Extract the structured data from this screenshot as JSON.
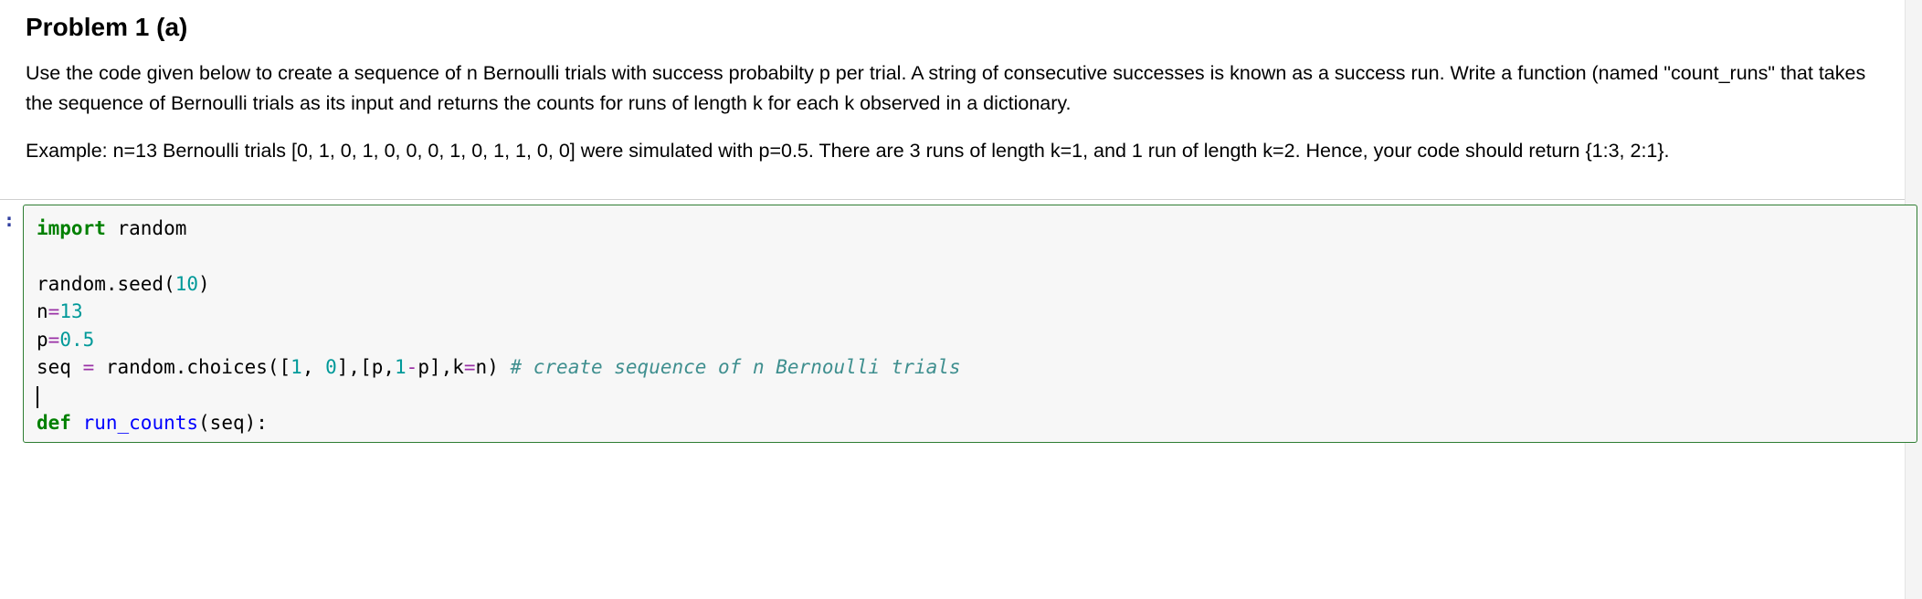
{
  "markdown": {
    "heading": "Problem 1 (a)",
    "para1": "Use the code given below to create a sequence of n Bernoulli trials with success probabilty p per trial. A string of consecutive successes is known as a success run. Write a function (named \"count_runs\" that takes the sequence of Bernoulli trials as its input and returns the counts for runs of length k for each k observed in a dictionary.",
    "para2": "Example: n=13 Bernoulli trials [0, 1, 0, 1, 0, 0, 0, 1, 0, 1, 1, 0, 0] were simulated with p=0.5. There are 3 runs of length k=1, and 1 run of length k=2. Hence, your code should return {1:3, 2:1}."
  },
  "prompt": {
    "label": ":"
  },
  "code": {
    "line1": {
      "kw_import": "import",
      "mod": " random"
    },
    "line3": {
      "pre": "random.seed(",
      "arg": "10",
      "post": ")"
    },
    "line4": {
      "var": "n",
      "eq": "=",
      "val": "13"
    },
    "line5": {
      "var": "p",
      "eq": "=",
      "val": "0.5"
    },
    "line6": {
      "pre": "seq ",
      "eq": "=",
      "mid1": " random.choices([",
      "n1": "1",
      "mid2": ", ",
      "n0": "0",
      "mid3": "],[p,",
      "one": "1",
      "minus": "-",
      "mid4": "p],k",
      "eq2": "=",
      "mid5": "n) ",
      "comment": "# create sequence of n Bernoulli trials"
    },
    "line8": {
      "kw_def": "def",
      "sp": " ",
      "name": "run_counts",
      "sig": "(seq):"
    }
  }
}
